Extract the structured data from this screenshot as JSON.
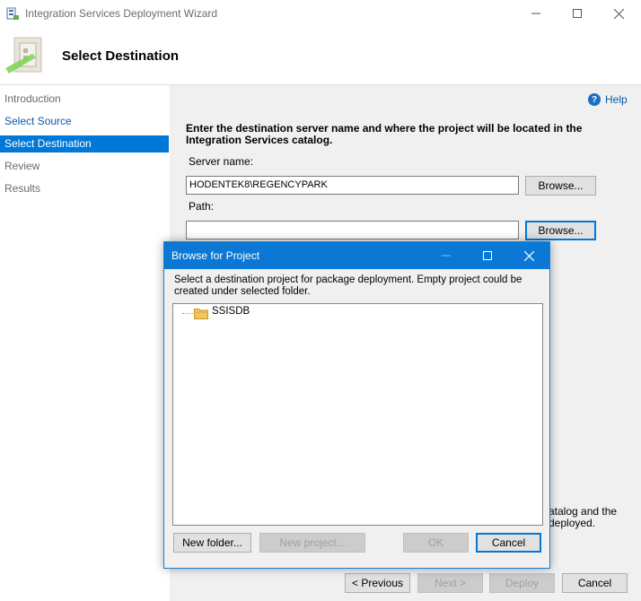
{
  "window": {
    "title": "Integration Services Deployment Wizard",
    "page_heading": "Select Destination"
  },
  "nav": {
    "items": [
      {
        "label": "Introduction",
        "state": "done"
      },
      {
        "label": "Select Source",
        "state": "link"
      },
      {
        "label": "Select Destination",
        "state": "active"
      },
      {
        "label": "Review",
        "state": "pending"
      },
      {
        "label": "Results",
        "state": "pending"
      }
    ]
  },
  "content": {
    "help_label": "Help",
    "instruction": "Enter the destination server name and where the project will be located in the Integration Services catalog.",
    "server_label": "Server name:",
    "server_value": "HODENTEK8\\REGENCYPARK",
    "path_label": "Path:",
    "path_value": "",
    "browse_label": "Browse...",
    "behind_text": "atalog and the deployed."
  },
  "footer": {
    "previous": "< Previous",
    "next": "Next >",
    "deploy": "Deploy",
    "cancel": "Cancel"
  },
  "dialog": {
    "title": "Browse for Project",
    "description": "Select a destination project for package deployment. Empty project could be created under selected folder.",
    "tree_items": [
      "SSISDB"
    ],
    "new_folder": "New folder...",
    "new_project": "New project...",
    "ok": "OK",
    "cancel": "Cancel"
  },
  "colors": {
    "accent": "#0078d7",
    "dialog_title_bar": "#0a78d4",
    "content_bg": "#f0f0f0"
  }
}
